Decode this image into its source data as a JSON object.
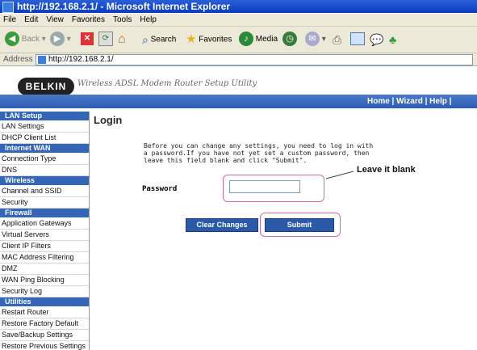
{
  "window": {
    "title": "http://192.168.2.1/ - Microsoft Internet Explorer"
  },
  "menu": [
    "File",
    "Edit",
    "View",
    "Favorites",
    "Tools",
    "Help"
  ],
  "toolbar": {
    "back": "Back",
    "search": "Search",
    "favorites": "Favorites",
    "media": "Media"
  },
  "address": {
    "label": "Address",
    "url": "http://192.168.2.1/"
  },
  "header": {
    "logo": "BELKIN",
    "tagline": "Wireless ADSL Modem Router Setup Utility",
    "nav": "Home | Wizard | Help | Logout   Int"
  },
  "sidebar": [
    {
      "section": "LAN Setup",
      "items": [
        "LAN Settings",
        "DHCP Client List"
      ]
    },
    {
      "section": "Internet WAN",
      "items": [
        "Connection Type",
        "DNS"
      ]
    },
    {
      "section": "Wireless",
      "items": [
        "Channel and SSID",
        "Security"
      ]
    },
    {
      "section": "Firewall",
      "items": [
        "Application Gateways",
        "Virtual Servers",
        "Client IP Filters",
        "MAC Address Filtering",
        "DMZ",
        "WAN Ping Blocking",
        "Security Log"
      ]
    },
    {
      "section": "Utilities",
      "items": [
        "Restart Router",
        "Restore Factory Default",
        "Save/Backup Settings",
        "Restore Previous Settings"
      ]
    }
  ],
  "main": {
    "title": "Login",
    "instructions": "Before you can change any settings, you need to log in with a password.If you have not yet set a custom password, then leave this field blank and click \"Submit\".",
    "annotation": "Leave it blank",
    "password_label": "Password",
    "password_value": "",
    "clear_button": "Clear Changes",
    "submit_button": "Submit"
  },
  "colors": {
    "nav_blue": "#2e5db3",
    "section_blue": "#3465b7",
    "highlight": "#d26aa8"
  }
}
